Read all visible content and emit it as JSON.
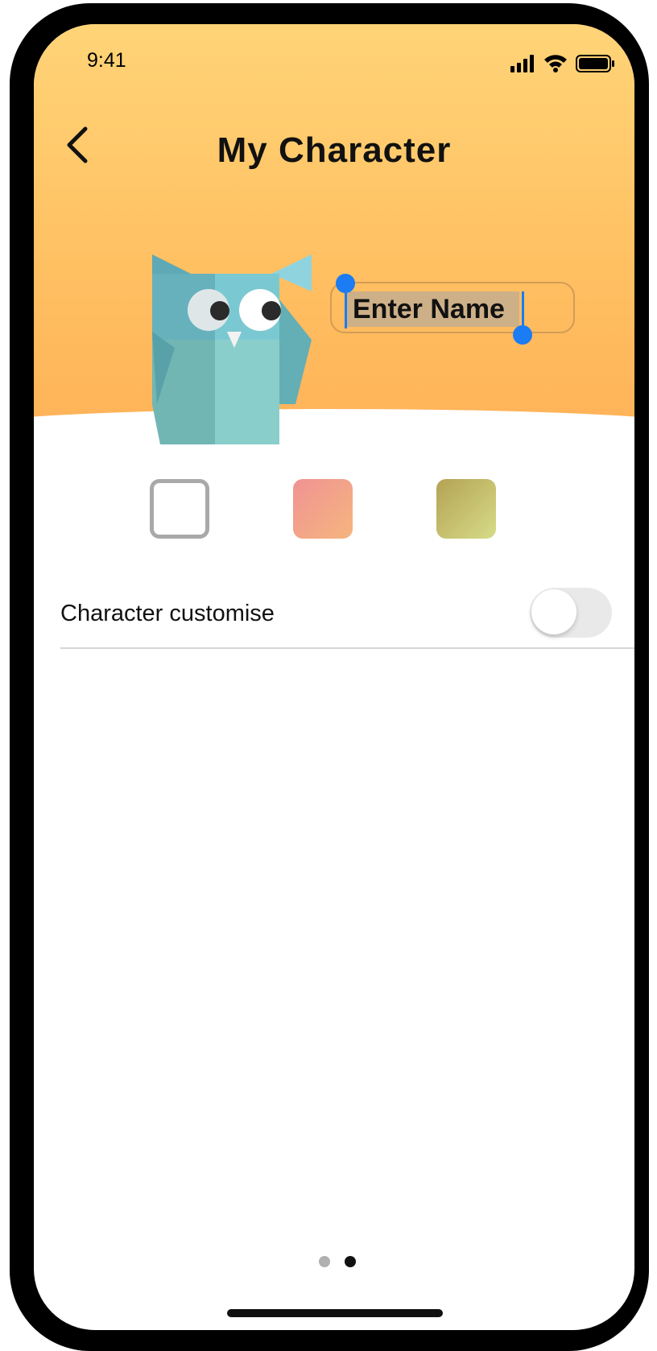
{
  "status_bar": {
    "time": "9:41",
    "icons": [
      "signal-icon",
      "wifi-icon",
      "battery-icon"
    ]
  },
  "header": {
    "title": "My Character",
    "back_icon": "chevron-left-icon"
  },
  "name_input": {
    "value": "Enter Name",
    "selected": true
  },
  "color_swatches": [
    {
      "name": "white",
      "selected": true
    },
    {
      "name": "pink-peach",
      "colors": [
        "#f09394",
        "#f5b57e"
      ]
    },
    {
      "name": "olive-yellow",
      "colors": [
        "#b4a254",
        "#d6dc88"
      ]
    }
  ],
  "settings": {
    "customise_label": "Character customise",
    "customise_enabled": false
  },
  "pager": {
    "pages": 2,
    "current": 2
  },
  "colors": {
    "header_top": "#ffd477",
    "header_bottom": "#ffb258",
    "selection": "#1b7cf4",
    "owl_body": "#6bb7c4"
  }
}
